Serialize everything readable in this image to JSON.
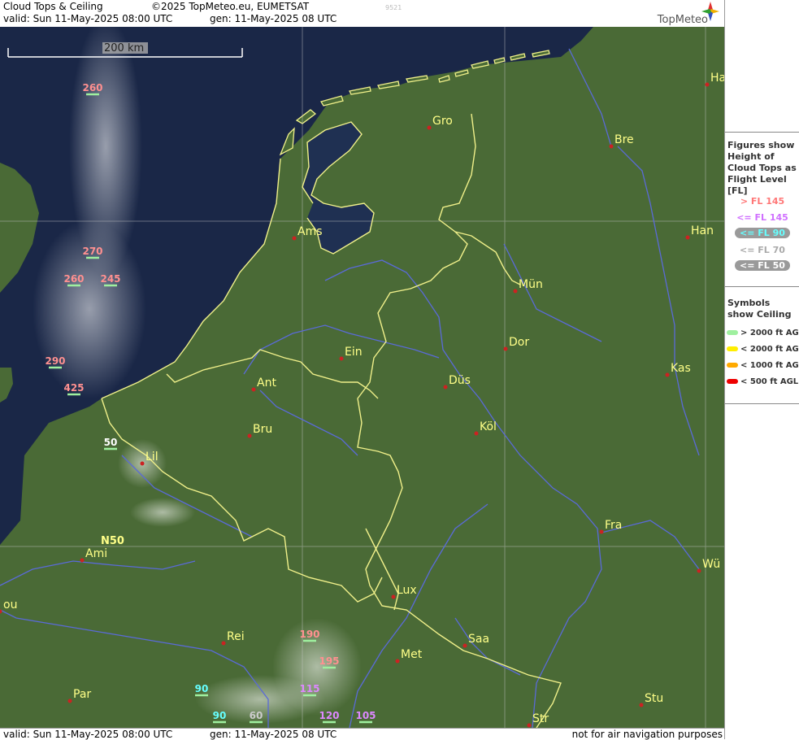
{
  "header": {
    "title": "Cloud Tops & Ceiling",
    "copyright": "©2025 TopMeteo.eu, EUMETSAT",
    "valid": "valid:  Sun  11-May-2025  08:00 UTC",
    "gen": "gen: 11-May-2025 08 UTC",
    "id": "9521",
    "brand": "TopMeteo"
  },
  "footer": {
    "valid": "valid:  Sun  11-May-2025  08:00 UTC",
    "gen": "gen: 11-May-2025 08 UTC",
    "disclaimer": "not for air navigation purposes"
  },
  "scale": {
    "label": "200 km"
  },
  "gridlabel": "N50",
  "cities": [
    {
      "name": "Gro"
    },
    {
      "name": "Bre"
    },
    {
      "name": "Ha"
    },
    {
      "name": "Ams"
    },
    {
      "name": "Han"
    },
    {
      "name": "Mün"
    },
    {
      "name": "Dor"
    },
    {
      "name": "Ein"
    },
    {
      "name": "Kas"
    },
    {
      "name": "Ant"
    },
    {
      "name": "Düs"
    },
    {
      "name": "Köl"
    },
    {
      "name": "Bru"
    },
    {
      "name": "Lil"
    },
    {
      "name": "Fra"
    },
    {
      "name": "Ami"
    },
    {
      "name": "Wü"
    },
    {
      "name": "Lux"
    },
    {
      "name": "ou"
    },
    {
      "name": "Rei"
    },
    {
      "name": "Saa"
    },
    {
      "name": "Met"
    },
    {
      "name": "Stu"
    },
    {
      "name": "Par"
    },
    {
      "name": "Str"
    }
  ],
  "flight_levels": [
    {
      "value": "260",
      "color": "#ff9090",
      "sym": "#9ff09f"
    },
    {
      "value": "270",
      "color": "#ff9090",
      "sym": "#9ff09f"
    },
    {
      "value": "260",
      "color": "#ff9090",
      "sym": "#9ff09f"
    },
    {
      "value": "245",
      "color": "#ff9090",
      "sym": "#9ff09f"
    },
    {
      "value": "290",
      "color": "#ff9090",
      "sym": "#9ff09f"
    },
    {
      "value": "425",
      "color": "#ff9090",
      "sym": "#9ff09f"
    },
    {
      "value": "50",
      "color": "#ffffff",
      "sym": "#9ff09f"
    },
    {
      "value": "190",
      "color": "#ff9090",
      "sym": "#9ff09f"
    },
    {
      "value": "195",
      "color": "#ff9090",
      "sym": "#9ff09f"
    },
    {
      "value": "115",
      "color": "#dd88ff",
      "sym": "#9ff09f"
    },
    {
      "value": "90",
      "color": "#66ffff",
      "sym": "#9ff09f"
    },
    {
      "value": "90",
      "color": "#66ffff",
      "sym": "#9ff09f"
    },
    {
      "value": "60",
      "color": "#cccccc",
      "sym": "#9ff09f"
    },
    {
      "value": "120",
      "color": "#dd88ff",
      "sym": "#9ff09f"
    },
    {
      "value": "105",
      "color": "#dd88ff",
      "sym": "#9ff09f"
    }
  ],
  "legend": {
    "heights_title": "Figures show Height of Cloud Tops as Flight Level  [FL]",
    "levels": [
      {
        "label": "> FL 145",
        "color": "#ff7777",
        "pill": false
      },
      {
        "label": "<= FL 145",
        "color": "#d070ff",
        "pill": false
      },
      {
        "label": "<= FL 90",
        "color": "#66ffff",
        "pill": true
      },
      {
        "label": "<= FL 70",
        "color": "#aaaaaa",
        "pill": false
      },
      {
        "label": "<= FL 50",
        "color": "#ffffff",
        "pill": true
      }
    ],
    "ceiling_title": "Symbols show Ceiling",
    "ceilings": [
      {
        "label": "> 2000 ft AGL",
        "color": "#9ff09f"
      },
      {
        "label": "< 2000 ft AGL",
        "color": "#ffee00"
      },
      {
        "label": "< 1000 ft AGL",
        "color": "#ffaa00"
      },
      {
        "label": "< 500 ft AGL",
        "color": "#ee0000"
      }
    ]
  },
  "colors": {
    "sea": "#1a2747",
    "land": "#4a6a36",
    "border": "#f0f08a",
    "river": "#5a6ad8",
    "city_dot": "#cc2222",
    "city_text": "#ffff88"
  }
}
